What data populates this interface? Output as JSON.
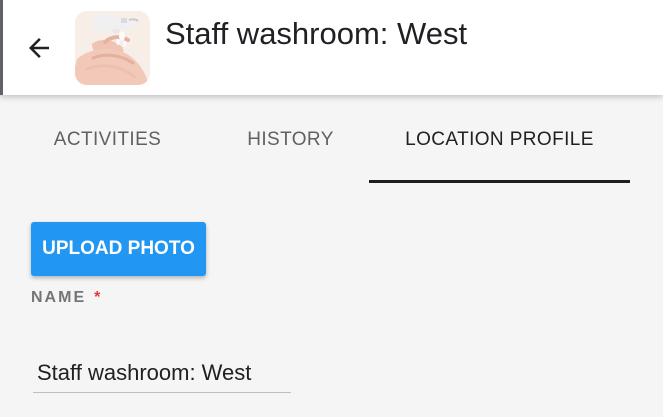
{
  "header": {
    "title": "Staff washroom: West",
    "back_icon": "arrow-left-icon",
    "thumbnail_icon": "hand-soap-photo"
  },
  "tabs": [
    {
      "label": "ACTIVITIES",
      "active": false
    },
    {
      "label": "HISTORY",
      "active": false
    },
    {
      "label": "LOCATION PROFILE",
      "active": true
    }
  ],
  "profile": {
    "upload_label": "UPLOAD PHOTO",
    "name_label": "NAME",
    "required_marker": "*",
    "name_value": "Staff washroom: West"
  },
  "colors": {
    "accent": "#2196f3",
    "required": "#e53935",
    "tab_indicator": "#1f1f1f"
  }
}
